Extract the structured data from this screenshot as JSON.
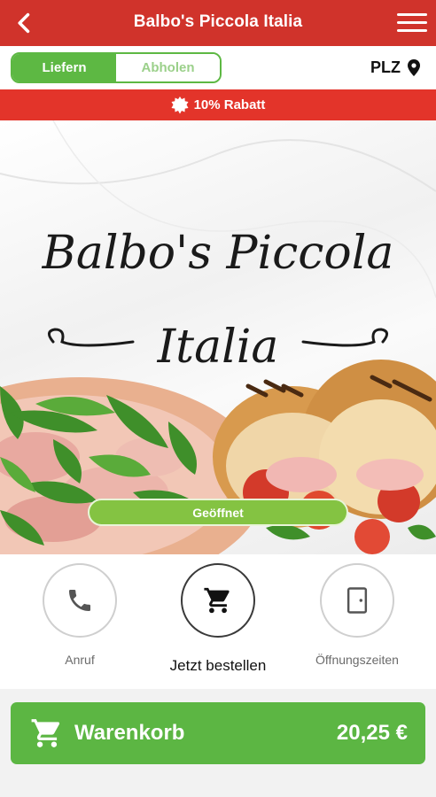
{
  "header": {
    "title": "Balbo's Piccola Italia",
    "back_icon": "chevron-left-icon",
    "menu_icon": "hamburger-menu-icon"
  },
  "mode_toggle": {
    "options": [
      "Liefern",
      "Abholen"
    ],
    "selected": "Liefern"
  },
  "location": {
    "label": "PLZ",
    "icon": "location-pin-icon"
  },
  "promo": {
    "text": "10% Rabatt",
    "icon": "discount-badge-icon"
  },
  "hero": {
    "logo_line1": "Balbo's Piccola",
    "logo_line2": "Italia",
    "status": "Geöffnet"
  },
  "actions": [
    {
      "label": "Anruf",
      "icon": "phone-icon"
    },
    {
      "label": "Jetzt bestellen",
      "icon": "cart-icon"
    },
    {
      "label": "Öffnungszeiten",
      "icon": "door-icon"
    }
  ],
  "cart": {
    "label": "Warenkorb",
    "total": "20,25 €",
    "icon": "cart-icon"
  },
  "colors": {
    "header_red": "#d0332b",
    "promo_red": "#e3342a",
    "green": "#5cb643",
    "status_green": "#84c342"
  }
}
